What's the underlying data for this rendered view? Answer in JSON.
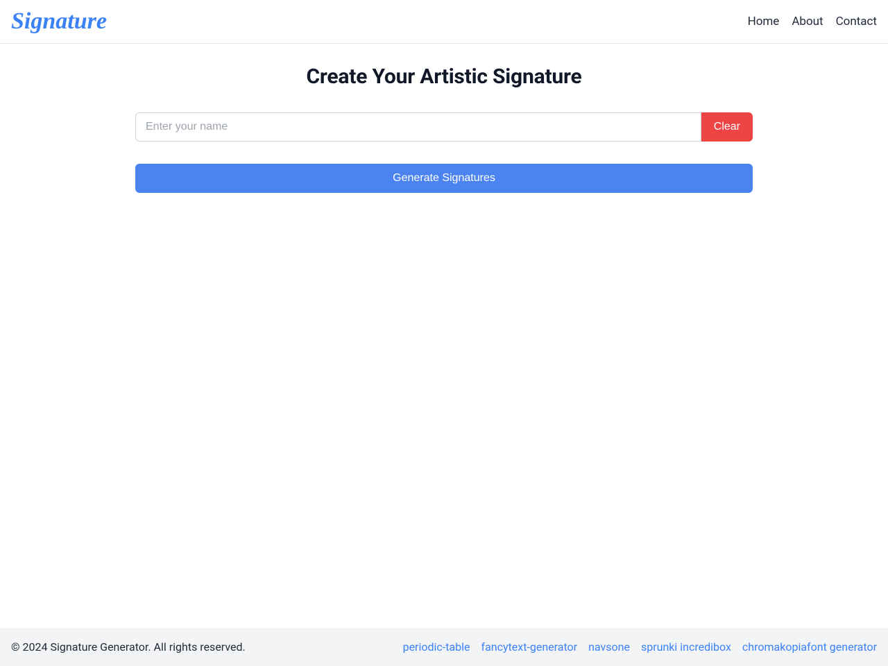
{
  "header": {
    "logo_text": "Signature",
    "nav": {
      "home": "Home",
      "about": "About",
      "contact": "Contact"
    }
  },
  "main": {
    "title": "Create Your Artistic Signature",
    "input": {
      "placeholder": "Enter your name",
      "value": ""
    },
    "clear_label": "Clear",
    "generate_label": "Generate Signatures"
  },
  "footer": {
    "copyright": "© 2024 Signature Generator. All rights reserved.",
    "links": {
      "periodic_table": "periodic-table",
      "fancytext_generator": "fancytext-generator",
      "navsone": "navsone",
      "sprunki_incredibox": "sprunki incredibox",
      "chromakopiafont_generator": "chromakopiafont generator"
    }
  },
  "colors": {
    "primary_blue": "#3b82f6",
    "button_blue": "#4b83f1",
    "danger_red": "#ef4444",
    "footer_bg": "#f3f4f6",
    "border": "#e5e7eb"
  }
}
